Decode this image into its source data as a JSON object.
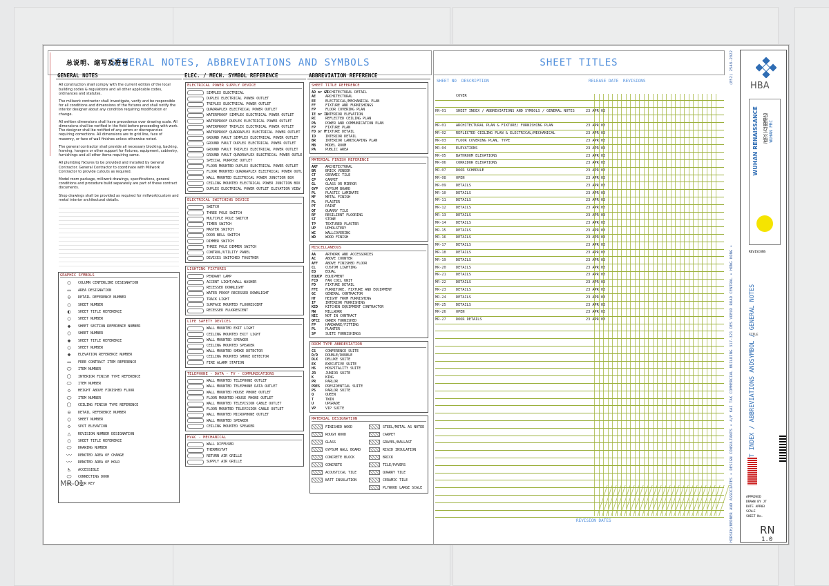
{
  "sheet": {
    "zh_header": "总说明、缩写及符号",
    "main_header": "GENERAL NOTES, ABBREVIATIONS AND SYMBOLS",
    "titles_header": "SHEET TITLES"
  },
  "general_notes": {
    "title": "GENERAL NOTES",
    "paragraphs": [
      "All construction shall comply with the current edition of the local building codes & regulations and all other applicable codes, ordinances and statutes.",
      "The millwork contractor shall investigate, verify and be responsible for all conditions and dimensions of the fixtures and shall notify the interior designer about any condition requiring modification or change.",
      "All written dimensions shall have precedence over drawing scale. All dimensions shall be verified in the field before proceeding with work. The designer shall be notified of any errors or discrepancies requiring corrections. All dimensions are to grid line, face of masonry, or face of wall finishes unless otherwise noted.",
      "The general contractor shall provide all necessary blocking, backing, framing, hangers or other support for fixtures, equipment, cabinetry, furnishings and all other items requiring same.",
      "All plumbing fixtures to be provided and installed by General Contractor. General Contractor to coordinate with Millwork Contractor to provide cutouts as required.",
      "Model room package, millwork drawings, specifications, general conditions and procedure build separately are part of these contract documents.",
      "Shop drawings shall be provided as required for millwork/custom and metal interior architectural details."
    ],
    "graphic_title": "GRAPHIC SYMBOLS",
    "graphic_items": [
      "COLUMN CENTERLINE DESIGNATION",
      "AREA DESIGNATION",
      "DETAIL REFERENCE NUMBER",
      "SHEET NUMBER",
      "SHEET TITLE REFERENCE",
      "SHEET NUMBER",
      "SHEET SECTION REFERENCE NUMBER",
      "SHEET NUMBER",
      "SHEET TITLE REFERENCE",
      "SHEET NUMBER",
      "ELEVATION REFERENCE NUMBER",
      "FREE CONTRACT ITEM REFERENCE",
      "ITEM NUMBER",
      "INTERIOR FINISH TYPE REFERENCE",
      "ITEM NUMBER",
      "HEIGHT ABOVE FINISHED FLOOR",
      "ITEM NUMBER",
      "CEILING FINISH TYPE REFERENCE",
      "DETAIL REFERENCE NUMBER",
      "SHEET NUMBER",
      "SPOT ELEVATION",
      "REVISION NUMBER DESIGNATION",
      "SHEET TITLE REFERENCE",
      "DRAWING NUMBER",
      "DENOTED AREA OF CHANGE",
      "DENOTED AREA OF HOLD",
      "ACCESSIBLE",
      "CONNECTING DOOR",
      "DOOR KEY"
    ],
    "mr_label": "MR-01"
  },
  "elec": {
    "title": "ELEC. / MECH. SYMBOL REFERENCE",
    "power_title": "ELECTRICAL POWER SUPPLY DEVICE",
    "power": [
      "SIMPLEX ELECTRICAL",
      "DUPLEX ELECTRICAL POWER OUTLET",
      "TRIPLEX ELECTRICAL POWER OUTLET",
      "QUADRAPLEX ELECTRICAL POWER OUTLET",
      "WATERPROOF SIMPLEX ELECTRICAL POWER OUTLET",
      "WATERPROOF DUPLEX ELECTRICAL POWER OUTLET",
      "WATERPROOF TRIPLEX ELECTRICAL POWER OUTLET",
      "WATERPROOF QUADRAPLEX ELECTRICAL POWER OUTLET",
      "GROUND FAULT SIMPLEX ELECTRICAL POWER OUTLET",
      "GROUND FAULT DUPLEX ELECTRICAL POWER OUTLET",
      "GROUND FAULT TRIPLEX ELECTRICAL POWER OUTLET",
      "GROUND FAULT QUADRAPLEX ELECTRICAL POWER OUTLET",
      "SPECIAL PURPOSE OUTLET",
      "FLOOR MOUNTED DUPLEX ELECTRICAL POWER OUTLET",
      "FLOOR MOUNTED QUADRAPLEX ELECTRICAL POWER OUTLET",
      "WALL MOUNTED ELECTRICAL POWER JUNCTION BOX",
      "CEILING MOUNTED ELECTRICAL POWER JUNCTION BOX",
      "DUPLEX ELECTRICAL POWER OUTLET ELEVATION VIEW"
    ],
    "switch_title": "ELECTRICAL SWITCHING DEVICE",
    "switch": [
      "SWITCH",
      "THREE POLE SWITCH",
      "MULTIPLE POLE SWITCH",
      "TIMER SWITCH",
      "MASTER SWITCH",
      "DOOR BELL SWITCH",
      "DIMMER SWITCH",
      "THREE POLE DIMMER SWITCH",
      "CONTROL/UTILITY PANEL",
      "DEVICES SWITCHED TOGETHER"
    ],
    "light_title": "LIGHTING FIXTURES",
    "light": [
      "PENDANT LAMP",
      "ACCENT LIGHT/WALL WASHER",
      "RECESSED DOWNLIGHT",
      "WATER PROOF RECESSED DOWNLIGHT",
      "TRACK LIGHT",
      "SURFACE MOUNTED FLUORESCENT",
      "RECESSED FLUORESCENT"
    ],
    "safety_title": "LIFE SAFETY DEVICES",
    "safety": [
      "WALL MOUNTED EXIT LIGHT",
      "CEILING MOUNTED EXIT LIGHT",
      "WALL MOUNTED SPEAKER",
      "CEILING MOUNTED SPEAKER",
      "WALL MOUNTED SMOKE DETECTOR",
      "CEILING MOUNTED SMOKE DETECTOR",
      "FIRE ALARM STATION"
    ],
    "tel_title": "TELEPHONE - DATA - TV - COMMUNICATIONS",
    "tel": [
      "WALL MOUNTED TELEPHONE OUTLET",
      "WALL MOUNTED TELEPHONE DATA OUTLET",
      "WALL MOUNTED HOUSE PHONE OUTLET",
      "FLOOR MOUNTED HOUSE PHONE OUTLET",
      "WALL MOUNTED TELEVISION CABLE OUTLET",
      "FLOOR MOUNTED TELEVISION CABLE OUTLET",
      "WALL MOUNTED MICROPHONE OUTLET",
      "WALL MOUNTED SPEAKER",
      "CEILING MOUNTED SPEAKER"
    ],
    "hvac_title": "HVAC - MECHANICAL",
    "hvac": [
      "WALL DIFFUSER",
      "THERMOSTAT",
      "RETURN AIR GRILLE",
      "SUPPLY AIR GRILLE"
    ]
  },
  "abbr": {
    "title": "ABBREVIATION REFERENCE",
    "title_ref": "SHEET TITLE REFERENCE",
    "title_items": [
      [
        "AD or GT",
        "ARCHITECTURAL DETAIL"
      ],
      [
        "AE",
        "ARCHITECTURAL"
      ],
      [
        "EE",
        "ELECTRICAL/MECHANICAL PLAN"
      ],
      [
        "FF",
        "FIXTURE AND FURNISHINGS"
      ],
      [
        "FP",
        "FLOOR COVERING PLAN"
      ],
      [
        "IE or IL",
        "INTERIOR ELEVATION"
      ],
      [
        "RC",
        "REFLECTED CEILING PLAN"
      ],
      [
        "PA",
        "POWER AND COMMUNICATION PLAN"
      ],
      [
        "FP",
        "FIXTURE PLAN"
      ],
      [
        "FD or F",
        "FIXTURE DETAIL"
      ],
      [
        "ID",
        "INTERIOR DETAIL"
      ],
      [
        "BR",
        "INTERIOR LANDSCAPING PLAN"
      ],
      [
        "MB",
        "MODEL ROOM"
      ],
      [
        "PA",
        "PUBLIC AREA"
      ]
    ],
    "material_title": "MATERIAL FINISH REFERENCE",
    "material_items": [
      [
        "ARF",
        "ARCHITECTURAL"
      ],
      [
        "BR",
        "BRICK VENEER"
      ],
      [
        "CT",
        "CERAMIC TILE"
      ],
      [
        "CP",
        "CARPET"
      ],
      [
        "GL",
        "GLASS OR MIRROR"
      ],
      [
        "GYP",
        "GYPSUM BOARD"
      ],
      [
        "PL",
        "PLASTIC LAMINATE"
      ],
      [
        "MF",
        "METAL FINISH"
      ],
      [
        "PL",
        "PLASTER"
      ],
      [
        "PT",
        "PAINT"
      ],
      [
        "QT",
        "QUARRY TILE"
      ],
      [
        "RF",
        "RESILIENT FLOORING"
      ],
      [
        "ST",
        "STONE"
      ],
      [
        "TP",
        "TEXTURED PLASTER"
      ],
      [
        "UP",
        "UPHOLSTERY"
      ],
      [
        "WC",
        "WALLCOVERING"
      ],
      [
        "WD",
        "WOOD FINISH"
      ]
    ],
    "misc_title": "MISCELLANEOUS",
    "misc_items": [
      [
        "AA",
        "ARTWORK AND ACCESSORIES"
      ],
      [
        "AC",
        "ABOVE COUNTER"
      ],
      [
        "AFF",
        "ABOVE FINISHED FLOOR"
      ],
      [
        "CL",
        "CUSTOM LIGHTING"
      ],
      [
        "EQ",
        "EQUAL"
      ],
      [
        "EQUIP",
        "EQUIPMENT"
      ],
      [
        "FCO",
        "FAN COIL UNIT"
      ],
      [
        "FD",
        "FIXTURE DETAIL"
      ],
      [
        "FFE",
        "FURNITURE, FIXTURE AND EQUIPMENT"
      ],
      [
        "GC",
        "GENERAL CONTRACTOR"
      ],
      [
        "HT",
        "HEIGHT FROM FURNISHING"
      ],
      [
        "IF",
        "INTERIOR FURNISHING"
      ],
      [
        "KED",
        "KITCHEN EQUIPMENT CONTRACTOR"
      ],
      [
        "MW",
        "MILLWORK"
      ],
      [
        "NIC",
        "NOT IN CONTRACT"
      ],
      [
        "OFCI",
        "OWNER FURNISHED"
      ],
      [
        "FP",
        "HARDWARE/FITTING"
      ],
      [
        "PL",
        "PLANTER"
      ],
      [
        "SP",
        "SUITE FURNISHINGS"
      ]
    ],
    "room_title": "ROOM TYPE ABBREVIATION",
    "room_items": [
      [
        "CS",
        "CONFERENCE SUITE"
      ],
      [
        "D/D",
        "DOUBLE/DOUBLE"
      ],
      [
        "DLX",
        "DELUXE SUITE"
      ],
      [
        "EX",
        "EXECUTIVE SUITE"
      ],
      [
        "HS",
        "HOSPITALITY SUITE"
      ],
      [
        "JR",
        "JUNIOR SUITE"
      ],
      [
        "K",
        "KING"
      ],
      [
        "PR",
        "PARLOR"
      ],
      [
        "PRES",
        "PRESIDENTIAL SUITE"
      ],
      [
        "PS",
        "PARLOR SUITE"
      ],
      [
        "Q",
        "QUEEN"
      ],
      [
        "T",
        "TWIN"
      ],
      [
        "U",
        "UPGRADE"
      ],
      [
        "VP",
        "VIP SUITE"
      ]
    ],
    "matdes_title": "MATERIAL DESIGNATION",
    "matdes_items": [
      "FINISHED WOOD",
      "ROUGH WOOD",
      "GLASS",
      "GYPSUM WALL BOARD",
      "CONCRETE BLOCK",
      "CONCRETE",
      "ACOUSTICAL TILE",
      "BATT INSULATION"
    ],
    "matdes_items2": [
      "STEEL/METAL AS NOTED",
      "CARPET",
      "GRAVEL/BALLAST",
      "RIGID INSULATION",
      "BRICK",
      "TILE/PAVERS",
      "QUARRY TILE",
      "CERAMIC TILE",
      "PLYWOOD LARGE SCALE"
    ]
  },
  "titles": {
    "col_sheetno": "SHEET NO",
    "col_desc": "DESCRIPTION",
    "col_release": "RELEASE DATE",
    "col_rev": "REVISIONS",
    "rows": [
      [
        "",
        "COVER",
        ""
      ],
      [
        "",
        "",
        ""
      ],
      [
        "RN-01",
        "SHEET INDEX / ABBREVIATIONS AND SYMBOLS / GENERAL NOTES",
        "23 APR 03"
      ],
      [
        "",
        "",
        ""
      ],
      [
        "MR-01",
        "ARCHITECTURAL PLAN & FIXTURE/ FURNISHING PLAN",
        "23 APR 03"
      ],
      [
        "MR-02",
        "REFLECTED CEILING PLAN & ELECTRICAL/MECHANICAL",
        "23 APR 03"
      ],
      [
        "MR-03",
        "FLOOR COVERING PLAN, TYPE",
        "23 APR 03"
      ],
      [
        "MR-04",
        "ELEVATIONS",
        "23 APR 03"
      ],
      [
        "MR-05",
        "BATHROOM ELEVATIONS",
        "23 APR 03"
      ],
      [
        "MR-06",
        "CORRIDOR ELEVATIONS",
        "23 APR 03"
      ],
      [
        "MR-07",
        "DOOR SCHEDULE",
        "23 APR 03"
      ],
      [
        "MR-08",
        "OPEN",
        "23 APR 03"
      ],
      [
        "MR-09",
        "DETAILS",
        "23 APR 03"
      ],
      [
        "MR-10",
        "DETAILS",
        "23 APR 03"
      ],
      [
        "MR-11",
        "DETAILS",
        "23 APR 03"
      ],
      [
        "MR-12",
        "DETAILS",
        "23 APR 03"
      ],
      [
        "MR-13",
        "DETAILS",
        "23 APR 03"
      ],
      [
        "MR-14",
        "DETAILS",
        "23 APR 03"
      ],
      [
        "MR-15",
        "DETAILS",
        "23 APR 03"
      ],
      [
        "MR-16",
        "DETAILS",
        "23 APR 03"
      ],
      [
        "MR-17",
        "DETAILS",
        "23 APR 03"
      ],
      [
        "MR-18",
        "DETAILS",
        "23 APR 03"
      ],
      [
        "MR-19",
        "DETAILS",
        "23 APR 03"
      ],
      [
        "MR-20",
        "DETAILS",
        "23 APR 03"
      ],
      [
        "MR-21",
        "DETAILS",
        "23 APR 03"
      ],
      [
        "MR-22",
        "DETAILS",
        "23 APR 03"
      ],
      [
        "MR-23",
        "DETAILS",
        "23 APR 03"
      ],
      [
        "MR-24",
        "DETAILS",
        "23 APR 03"
      ],
      [
        "MR-25",
        "DETAILS",
        "23 APR 03"
      ],
      [
        "MR-26",
        "OPEN",
        "23 APR 03"
      ],
      [
        "MR-27",
        "DOOR DETAILS",
        "23 APR 03"
      ]
    ],
    "revision_dates": "REVISION DATES"
  },
  "titleblock": {
    "firm": "HBA",
    "phone": "(852) 2548-2022",
    "address": "HIRSCH/BEDNER AND ASSOCIATES • DESIGN CONSULTANTS • 4/F KAI TAK COMMERCIAL BUILDING 317-321 DES VOEUX ROAD CENTRAL • HONG KONG •",
    "project": "WUHAN RENAISSANCE",
    "project_zh": "武汉 万丽酒店",
    "project_sub": "WUHAN PRC",
    "revisions_label": "REVISIONS",
    "title_label": "TITLE",
    "drawing_title": "SHEET INDEX / ABBREVIATIONS ANDSYMBOL / GENERAL NOTES",
    "approved": "APPROVED",
    "drawn_by": "DRAWN BY",
    "drawn_val": "JT",
    "date_label": "DATE",
    "date_val": "APR03",
    "scale_label": "SCALE",
    "sheet_label": "SHEET No.",
    "sheet_no": "RN",
    "sheet_no2": "1.0",
    "mr_watermark_a": "MR",
    "revision_legend": "REVISION"
  },
  "colors": {
    "header_blue": "#4f8edb",
    "grid_green": "#b9c76a",
    "box_red": "#8b1a1a",
    "logo_blue": "#2f6db4",
    "logo_yellow": "#f5e400"
  }
}
